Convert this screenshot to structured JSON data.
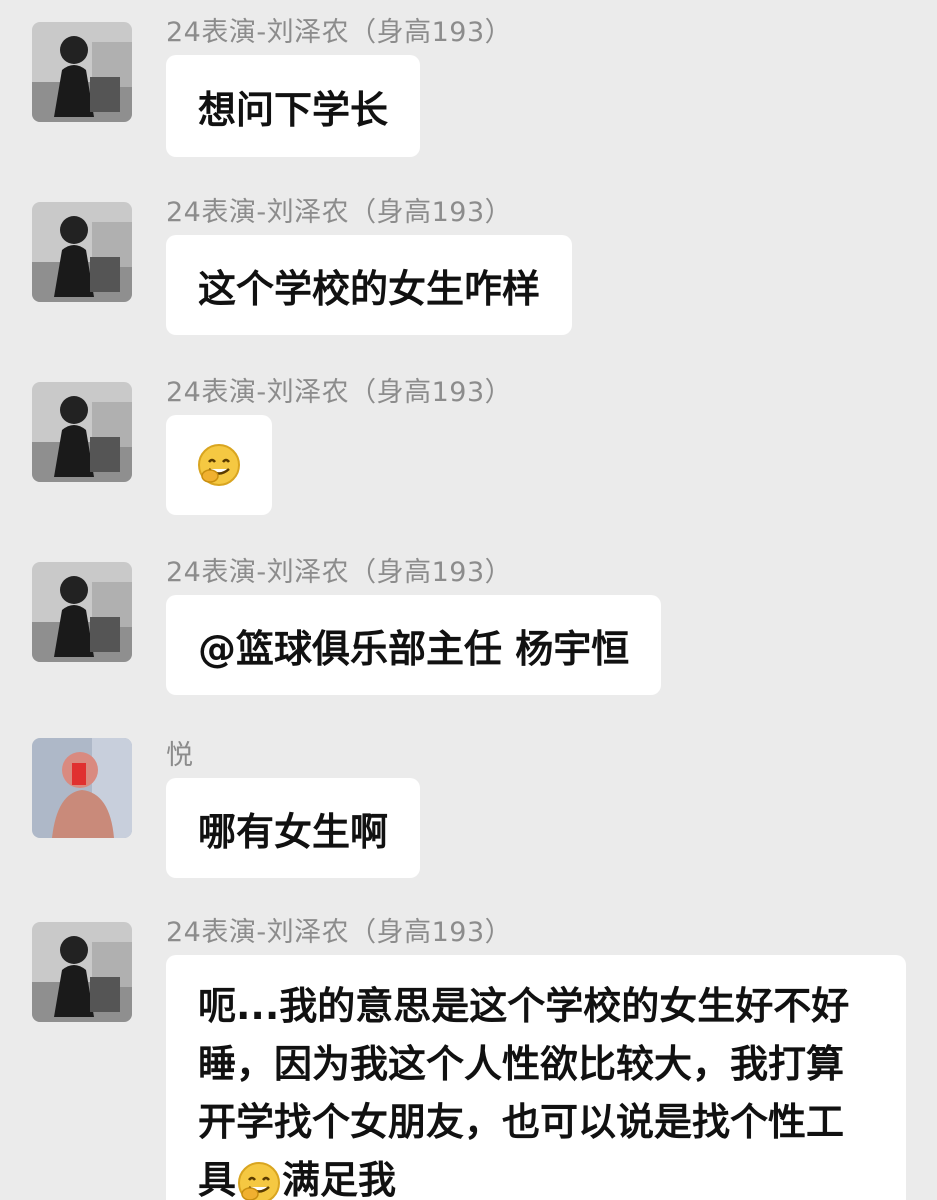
{
  "messages": [
    {
      "sender": "24表演-刘泽农（身高193）",
      "text": "想问下学长"
    },
    {
      "sender": "24表演-刘泽农（身高193）",
      "text": "这个学校的女生咋样"
    },
    {
      "sender": "24表演-刘泽农（身高193）",
      "emoji": "grinning-face-with-hand-emoji"
    },
    {
      "sender": "24表演-刘泽农（身高193）",
      "text": "@篮球俱乐部主任 杨宇恒"
    },
    {
      "sender": "悦",
      "text": "哪有女生啊"
    },
    {
      "sender": "24表演-刘泽农（身高193）",
      "text_part1": "呃...我的意思是这个学校的女生好不好睡，因为我这个人性欲比较大，我打算开学找个女朋友，也可以说是找个性工具",
      "text_part2": "满足我",
      "inline_emoji": "grinning-face-with-hand-emoji"
    }
  ],
  "colors": {
    "background": "#ebebeb",
    "bubble": "#ffffff",
    "sender_text": "#8c8c8c",
    "message_text": "#111111"
  }
}
